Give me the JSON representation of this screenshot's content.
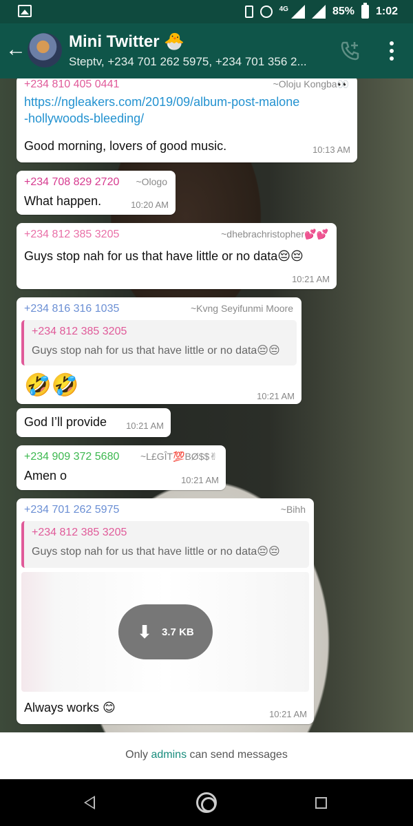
{
  "status_bar": {
    "network": "4G",
    "battery": "85%",
    "time": "1:02"
  },
  "header": {
    "title": "Mini Twitter 🐣",
    "subtitle": "Steptv, +234 701 262 5975, +234 701 356 2..."
  },
  "messages": [
    {
      "sender": "+234 810 405 0441",
      "sender_color": "#e05a99",
      "alias": "~Oloju Kongba👀",
      "link_line1": "https://ngleakers.com/2019/09/album-post-malone",
      "link_line2": "-hollywoods-bleeding/",
      "text": "Good morning, lovers of good music.",
      "time": "10:13 AM"
    },
    {
      "sender": "+234 708 829 2720",
      "sender_color": "#d63a8f",
      "alias": "~Ologo",
      "text": "What happen.",
      "time": "10:20 AM"
    },
    {
      "sender": "+234 812 385 3205",
      "sender_color": "#e96fa7",
      "alias": "~dhebrachristopher💕💕",
      "text": "Guys stop nah for us that have little or no data😔😔",
      "time": "10:21 AM"
    },
    {
      "sender": "+234 816 316 1035",
      "sender_color": "#6b8fd4",
      "alias": "~Kvng Seyifunmi Moore",
      "quote_sender": "+234 812 385 3205",
      "quote_text": "Guys stop nah for us that have little or no data😔😔",
      "text": "🤣🤣",
      "time": "10:21 AM"
    },
    {
      "text": "God I’ll provide",
      "time": "10:21 AM"
    },
    {
      "sender": "+234 909 372 5680",
      "sender_color": "#3cb84f",
      "alias": "~L£GÎT💯BØ$$✌",
      "text": "Amen o",
      "time": "10:21 AM"
    },
    {
      "sender": "+234 701 262 5975",
      "sender_color": "#6b8fd4",
      "alias": "~Bihh",
      "quote_sender": "+234 812 385 3205",
      "quote_text": "Guys stop nah for us that have little or no data😔😔",
      "download_size": "3.7 KB",
      "text": "Always works 😊",
      "time": "10:21 AM"
    }
  ],
  "footer": {
    "prefix": "Only ",
    "link": "admins",
    "suffix": " can send messages"
  }
}
